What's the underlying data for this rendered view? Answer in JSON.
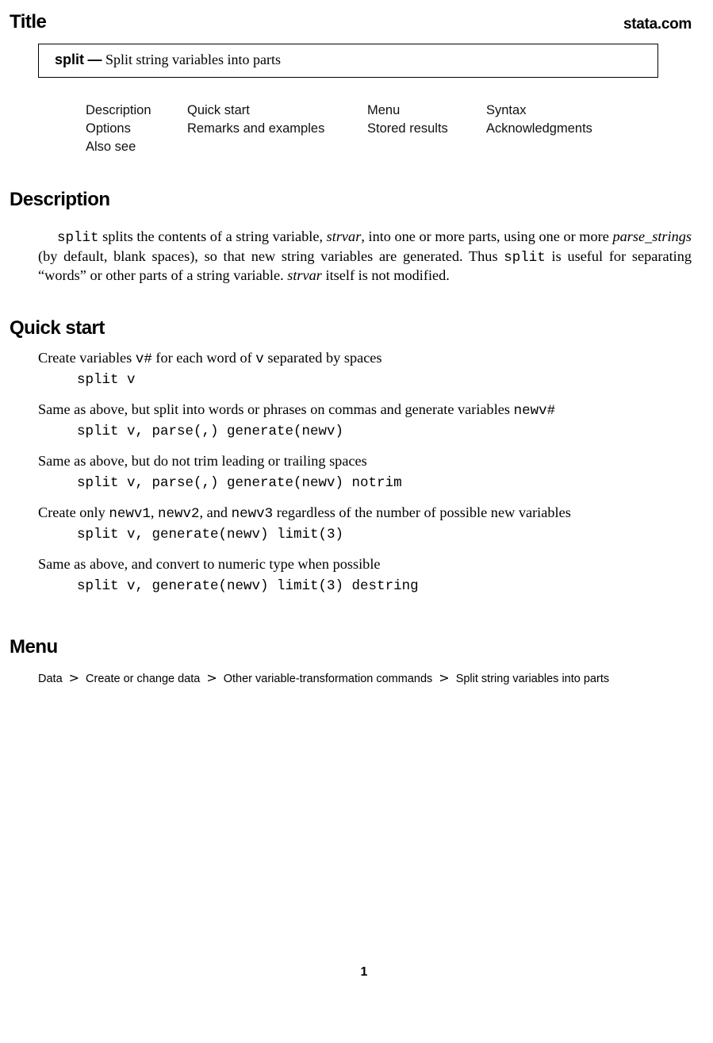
{
  "header": {
    "section_label": "Title",
    "site": "stata.com"
  },
  "title_box": {
    "command": "split",
    "dash": "—",
    "description": "Split string variables into parts"
  },
  "toc": {
    "items": [
      {
        "label": "Description"
      },
      {
        "label": "Quick start"
      },
      {
        "label": "Menu"
      },
      {
        "label": "Syntax"
      },
      {
        "label": "Options"
      },
      {
        "label": "Remarks and examples"
      },
      {
        "label": "Stored results"
      },
      {
        "label": "Acknowledgments"
      },
      {
        "label": "Also see"
      }
    ]
  },
  "description": {
    "heading": "Description",
    "parts": {
      "p1_cmd": "split",
      "p1_a": " splits the contents of a string variable, ",
      "p1_strvar": "strvar",
      "p1_b": ", into one or more parts, using one or more ",
      "p1_parse": "parse_strings",
      "p1_c": " (by default, blank spaces), so that new string variables are generated. Thus ",
      "p1_cmd2": "split",
      "p1_d": " is useful for separating “words” or other parts of a string variable. ",
      "p1_strvar2": "strvar",
      "p1_e": " itself is not modified."
    }
  },
  "quick_start": {
    "heading": "Quick start",
    "examples": [
      {
        "desc_a": "Create variables ",
        "desc_code": "v#",
        "desc_b": " for each word of ",
        "desc_code2": "v",
        "desc_c": " separated by spaces",
        "command": "split v"
      },
      {
        "desc_a": "Same as above, but split into words or phrases on commas and generate variables ",
        "desc_code": "newv#",
        "command": "split v, parse(,) generate(newv)"
      },
      {
        "desc_a": "Same as above, but do not trim leading or trailing spaces",
        "command": "split v, parse(,) generate(newv) notrim"
      },
      {
        "desc_a": "Create only ",
        "desc_code": "newv1",
        "desc_b": ", ",
        "desc_code2": "newv2",
        "desc_c": ", and ",
        "desc_code3": "newv3",
        "desc_d": " regardless of the number of possible new variables",
        "command": "split v, generate(newv) limit(3)"
      },
      {
        "desc_a": "Same as above, and convert to numeric type when possible",
        "command": "split v, generate(newv) limit(3) destring"
      }
    ]
  },
  "menu": {
    "heading": "Menu",
    "separator": ">",
    "path": [
      "Data",
      "Create or change data",
      "Other variable-transformation commands",
      "Split string variables into parts"
    ]
  },
  "footer": {
    "page_number": "1"
  }
}
